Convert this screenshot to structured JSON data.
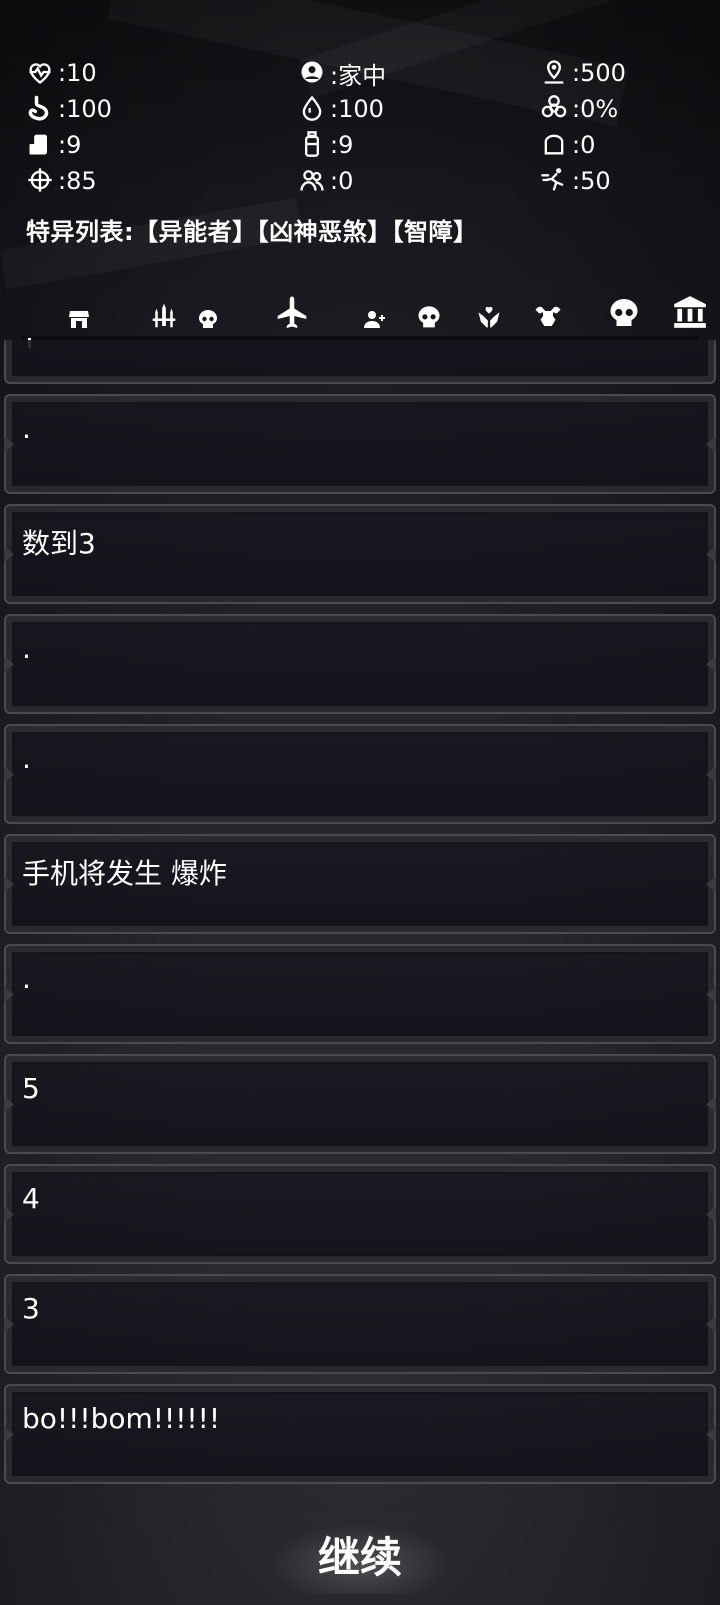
{
  "stats": [
    {
      "icon": "heart-pulse-icon",
      "value": ":10"
    },
    {
      "icon": "globe-user-icon",
      "value": ":家中"
    },
    {
      "icon": "map-pin-icon",
      "value": ":500"
    },
    {
      "icon": "stomach-icon",
      "value": ":100"
    },
    {
      "icon": "water-drop-icon",
      "value": ":100"
    },
    {
      "icon": "biohazard-icon",
      "value": ":0%"
    },
    {
      "icon": "food-can-icon",
      "value": ":9"
    },
    {
      "icon": "water-bottle-icon",
      "value": ":9"
    },
    {
      "icon": "bread-icon",
      "value": ":0"
    },
    {
      "icon": "crosshair-icon",
      "value": ":85"
    },
    {
      "icon": "people-icon",
      "value": ":0"
    },
    {
      "icon": "running-person-icon",
      "value": ":50"
    }
  ],
  "traits": "特异列表:【异能者】【凶神恶煞】【智障】",
  "toolbar": [
    "shop-icon",
    "weapons-icon",
    "skull-small-icon",
    "airplane-icon",
    "add-user-icon",
    "skull-icon",
    "hands-heart-icon",
    "muscle-icon",
    "skull-large-icon",
    "bank-icon"
  ],
  "log": [
    {
      "text": ""
    },
    {
      "text": "."
    },
    {
      "text": "数到3"
    },
    {
      "text": "."
    },
    {
      "text": "."
    },
    {
      "text": "手机将发生 爆炸"
    },
    {
      "text": "."
    },
    {
      "text": "5"
    },
    {
      "text": "4"
    },
    {
      "text": "3"
    },
    {
      "text": "bo!!!bom!!!!!!"
    }
  ],
  "continue_label": "继续"
}
